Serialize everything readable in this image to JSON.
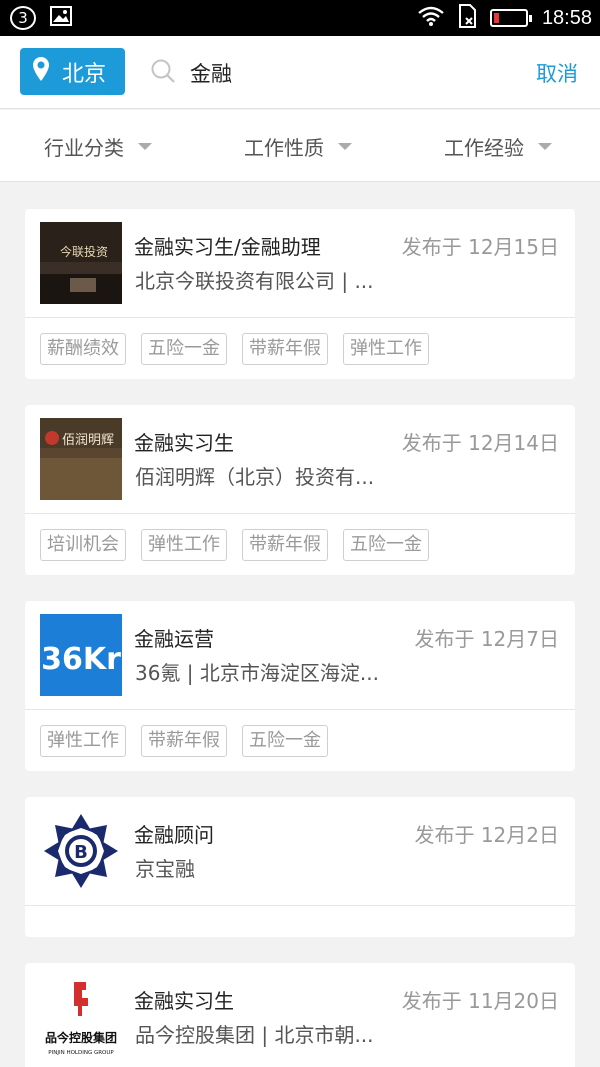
{
  "status_bar": {
    "sim": "3",
    "time": "18:58"
  },
  "search": {
    "city": "北京",
    "query": "金融",
    "cancel": "取消"
  },
  "filters": [
    "行业分类",
    "工作性质",
    "工作经验"
  ],
  "jobs": [
    {
      "title": "金融实习生/金融助理",
      "date": "发布于 12月15日",
      "company": "北京今联投资有限公司 | ...",
      "tags": [
        "薪酬绩效",
        "五险一金",
        "带薪年假",
        "弹性工作"
      ]
    },
    {
      "title": "金融实习生",
      "date": "发布于 12月14日",
      "company": "佰润明辉（北京）投资有...",
      "tags": [
        "培训机会",
        "弹性工作",
        "带薪年假",
        "五险一金"
      ]
    },
    {
      "title": "金融运营",
      "date": "发布于 12月7日",
      "company": "36氪 | 北京市海淀区海淀...",
      "tags": [
        "弹性工作",
        "带薪年假",
        "五险一金"
      ]
    },
    {
      "title": "金融顾问",
      "date": "发布于 12月2日",
      "company": "京宝融",
      "tags": []
    },
    {
      "title": "金融实习生",
      "date": "发布于 11月20日",
      "company": "品今控股集团 | 北京市朝...",
      "tags": []
    }
  ],
  "logos": {
    "job1": "今联投资",
    "job2": "佰润明辉",
    "job3": "36Kr",
    "job5_main": "品今控股集团",
    "job5_sub": "PINJIN HOLDING GROUP"
  },
  "colors": {
    "accent": "#1d9bd8",
    "logo_36kr": "#1c7ed6"
  }
}
